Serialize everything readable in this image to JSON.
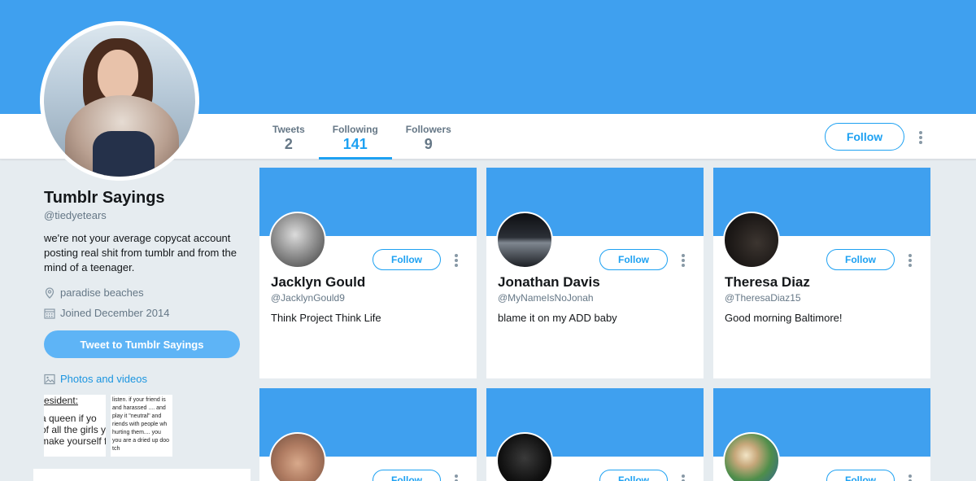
{
  "profile": {
    "name": "Tumblr Sayings",
    "handle": "@tiedyetears",
    "bio": "we're not your average copycat account posting real shit from tumblr and from the mind of a teenager.",
    "location": "paradise beaches",
    "joined": "Joined December 2014",
    "tweet_to_label": "Tweet to Tumblr Sayings",
    "photos_label": "Photos and videos"
  },
  "stats": [
    {
      "label": "Tweets",
      "value": "2"
    },
    {
      "label": "Following",
      "value": "141",
      "active": true
    },
    {
      "label": "Followers",
      "value": "9"
    }
  ],
  "follow_label": "Follow",
  "thumbnails": {
    "thumb1_lines": [
      "resident:",
      "",
      "a queen if yo",
      "of all the girls y",
      "make yourself f"
    ],
    "thumb2_lines": [
      "listen. if your friend is",
      "and harassed .... and",
      "play it \"neutral\" and",
      "riends with people wh",
      "hurting them.... you",
      "you are a dried up doo",
      "tch"
    ]
  },
  "cards": [
    {
      "name": "Jacklyn Gould",
      "handle": "@JacklynGould9",
      "bio": "Think Project Think Life",
      "follow_label": "Follow"
    },
    {
      "name": "Jonathan Davis",
      "handle": "@MyNameIsNoJonah",
      "bio": "blame it on my ADD baby",
      "follow_label": "Follow"
    },
    {
      "name": "Theresa Diaz",
      "handle": "@TheresaDiaz15",
      "bio": "Good morning Baltimore!",
      "follow_label": "Follow"
    },
    {
      "name": "",
      "handle": "",
      "bio": "",
      "follow_label": "Follow"
    },
    {
      "name": "",
      "handle": "",
      "bio": "",
      "follow_label": "Follow"
    },
    {
      "name": "",
      "handle": "",
      "bio": "",
      "follow_label": "Follow"
    }
  ],
  "colors": {
    "banner": "#3fa0ef",
    "accent": "#1da1f2",
    "background": "#e6ecf0"
  }
}
